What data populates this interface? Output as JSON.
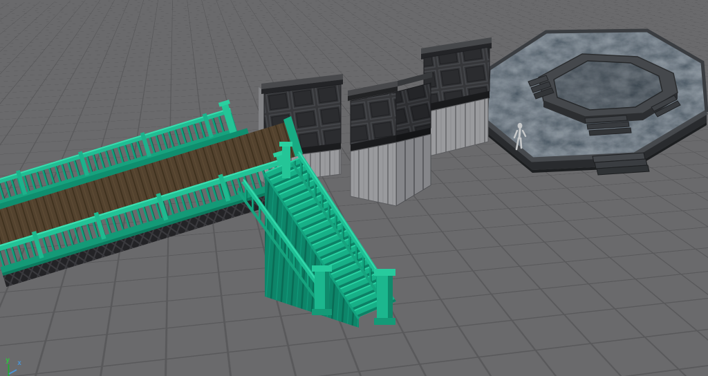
{
  "viewport": {
    "type": "3d-perspective-viewport",
    "background_color": "#6a6a6c",
    "grid": {
      "visible": true,
      "line_color": "#59595b"
    },
    "axis_gizmo": {
      "y_label": "y",
      "y_color": "#2ec73f",
      "x_label": "x",
      "x_color": "#4b93d1"
    },
    "objects": [
      {
        "name": "footbridge",
        "description": "teal footbridge with wooden plank deck and baluster railings",
        "primary_color": "#16ad85",
        "deck_color": "#5d4a34"
      },
      {
        "name": "staircase",
        "description": "teal staircase descending from the bridge deck with newel posts",
        "primary_color": "#17b087"
      },
      {
        "name": "wall-segment-left",
        "description": "dark paneled wall section on light plank base",
        "panel_color": "#36373a",
        "base_color": "#9a9b9e"
      },
      {
        "name": "wall-segment-middle",
        "description": "L-shaped dark paneled wall section on light plank base",
        "panel_color": "#36373a",
        "base_color": "#9a9b9e"
      },
      {
        "name": "wall-segment-right",
        "description": "tall dark paneled wall section on light plank base",
        "panel_color": "#36373a",
        "base_color": "#9a9b9e"
      },
      {
        "name": "octagonal-platform",
        "description": "octagonal stone platform with raised inner ring and steps",
        "surface_color": "#303a42",
        "rim_color": "#46494d"
      },
      {
        "name": "human-scale-figure",
        "description": "small light-gray human reference figure",
        "color": "#c8cacb"
      }
    ]
  }
}
